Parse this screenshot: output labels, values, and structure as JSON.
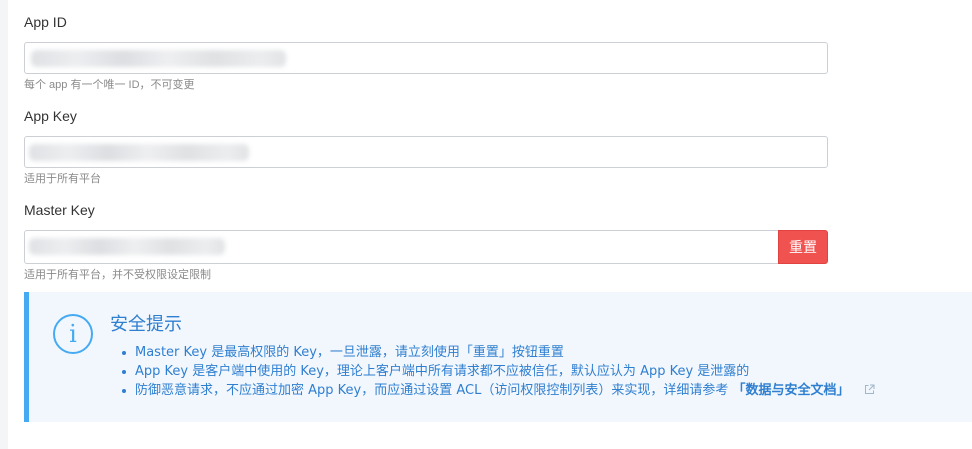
{
  "fields": {
    "app_id": {
      "label": "App ID",
      "help": "每个 app 有一个唯一 ID，不可变更"
    },
    "app_key": {
      "label": "App Key",
      "help": "适用于所有平台"
    },
    "master_key": {
      "label": "Master Key",
      "help": "适用于所有平台，并不受权限设定限制",
      "reset_label": "重置"
    }
  },
  "notice": {
    "icon": "info-icon",
    "icon_glyph": "i",
    "title": "安全提示",
    "items": [
      {
        "text": "Master Key 是最高权限的 Key，一旦泄露，请立刻使用「重置」按钮重置"
      },
      {
        "text": "App Key 是客户端中使用的 Key，理论上客户端中所有请求都不应被信任，默认应认为 App Key 是泄露的"
      },
      {
        "text": "防御恶意请求，不应通过加密 App Key，而应通过设置 ACL（访问权限控制列表）来实现，详细请参考",
        "link": "「数据与安全文档」",
        "link_icon": "external-link-icon"
      }
    ]
  },
  "colors": {
    "accent": "#45aaf2",
    "notice_text": "#2f7fd0",
    "danger": "#f0524f"
  }
}
